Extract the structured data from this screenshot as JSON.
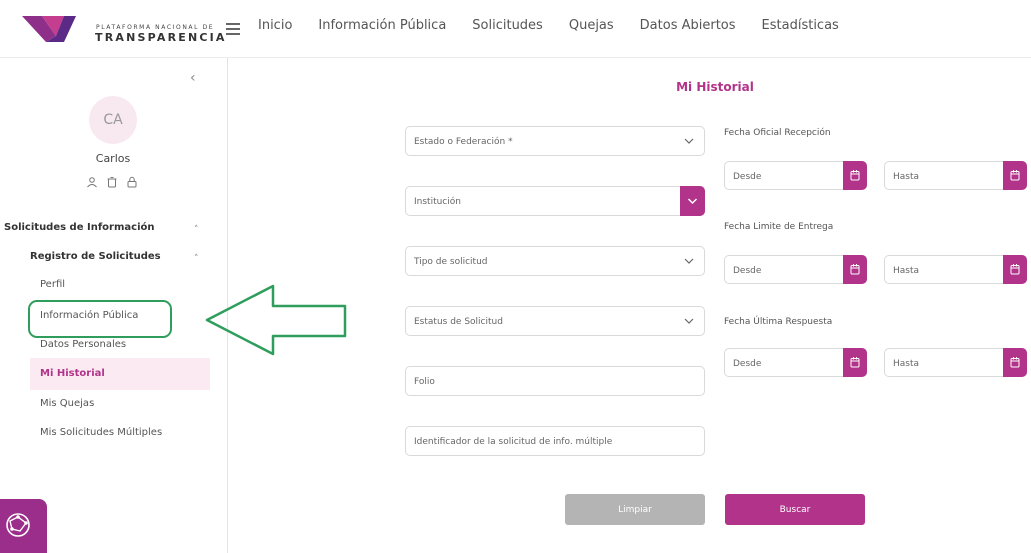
{
  "header": {
    "logo_small": "PLATAFORMA NACIONAL DE",
    "logo_big": "TRANSPARENCIA",
    "nav": [
      "Inicio",
      "Información Pública",
      "Solicitudes",
      "Quejas",
      "Datos Abiertos",
      "Estadísticas"
    ]
  },
  "sidebar": {
    "avatar": "CA",
    "user_name": "Carlos",
    "section": "Solicitudes de Información",
    "subsection": "Registro de Solicitudes",
    "items": [
      "Perfil",
      "Información Pública",
      "Datos Personales",
      "Mi Historial",
      "Mis Quejas",
      "Mis Solicitudes Múltiples"
    ],
    "active_item": "Mi Historial"
  },
  "main": {
    "title": "Mi Historial",
    "fields": {
      "estado": "Estado o Federación *",
      "institucion": "Institución",
      "tipo": "Tipo de solicitud",
      "estatus": "Estatus de Solicitud",
      "folio": "Folio",
      "identificador": "Identificador de la solicitud de info. múltiple"
    },
    "dates": {
      "recepcion_label": "Fecha Oficial Recepción",
      "entrega_label": "Fecha Limite de Entrega",
      "respuesta_label": "Fecha Última Respuesta",
      "desde": "Desde",
      "hasta": "Hasta"
    },
    "buttons": {
      "clear": "Limpiar",
      "search": "Buscar"
    }
  },
  "colors": {
    "accent": "#b1338a",
    "highlight_green": "#2f9e5c",
    "active_bg": "#fbeaf1"
  }
}
